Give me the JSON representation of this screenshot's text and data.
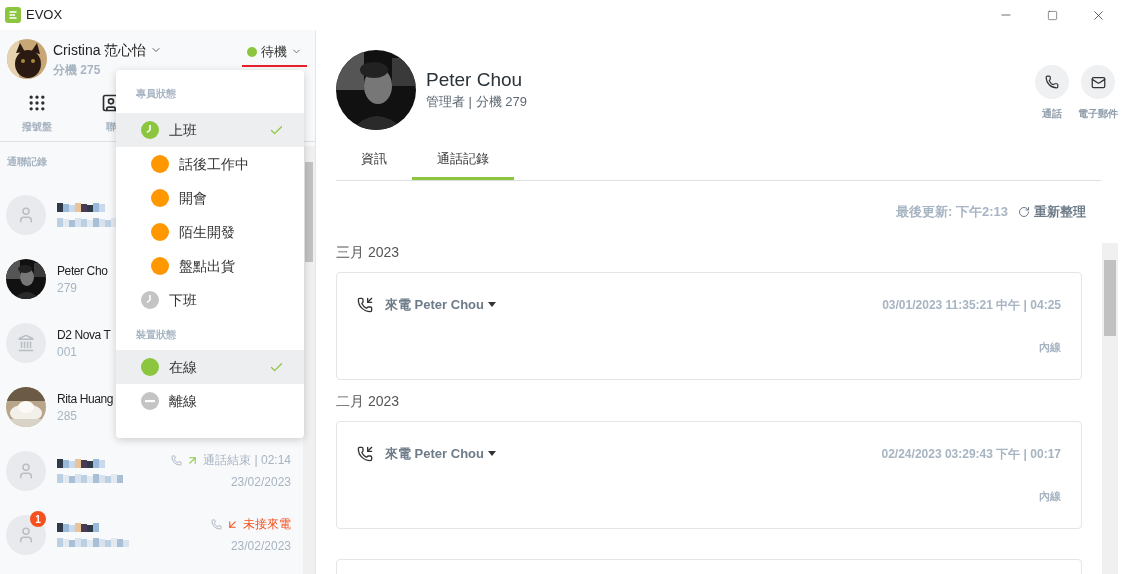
{
  "app": {
    "title": "EVOX"
  },
  "user": {
    "name": "Cristina 范心怡",
    "extension": "分機 275",
    "status": "待機"
  },
  "toolbar": [
    {
      "label": "撥號盤",
      "kind": "dialpad"
    },
    {
      "label": "聯",
      "kind": "contacts"
    }
  ],
  "recent": {
    "title": "通聯記錄",
    "items": [
      {
        "kind": "person"
      },
      {
        "kind": "photo_dark",
        "name": "Peter Cho",
        "sub": "279"
      },
      {
        "kind": "building",
        "name": "D2 Nova T",
        "sub": "001"
      },
      {
        "kind": "photo_light",
        "name": "Rita Huang",
        "sub": "285"
      },
      {
        "kind": "person",
        "call": {
          "kind": "ended",
          "text": "通話結束 | 02:14",
          "date": "23/02/2023"
        }
      },
      {
        "kind": "person",
        "badge": "1",
        "call": {
          "kind": "missed",
          "text": "未接來電",
          "date": "23/02/2023"
        }
      }
    ]
  },
  "status_menu": {
    "sections": [
      {
        "title": "專員狀態",
        "items": [
          {
            "label": "上班",
            "kind": "clock",
            "color": "#8cc63f",
            "selected": true,
            "children": [
              {
                "label": "話後工作中",
                "kind": "dot",
                "color": "#ff9800",
                "selected": false
              },
              {
                "label": "開會",
                "kind": "dot",
                "color": "#ff9800",
                "selected": false
              },
              {
                "label": "陌生開發",
                "kind": "dot",
                "color": "#ff9800",
                "selected": false
              },
              {
                "label": "盤點出貨",
                "kind": "dot",
                "color": "#ff9800",
                "selected": false
              }
            ]
          },
          {
            "label": "下班",
            "kind": "clock",
            "color": "#c4c4c4",
            "selected": false
          }
        ]
      },
      {
        "title": "裝置狀態",
        "items": [
          {
            "label": "在線",
            "kind": "dot",
            "color": "#8cc63f",
            "selected": true
          },
          {
            "label": "離線",
            "kind": "minus",
            "color": "#c4c4c4",
            "selected": false
          }
        ]
      }
    ]
  },
  "contact": {
    "name": "Peter Chou",
    "role": "管理者 | 分機 279",
    "actions": [
      {
        "label": "通話",
        "kind": "call"
      },
      {
        "label": "電子郵件",
        "kind": "email"
      }
    ],
    "tabs": [
      {
        "label": "資訊",
        "selected": false
      },
      {
        "label": "通話記錄",
        "selected": true
      }
    ],
    "last_updated": "最後更新: 下午2:13",
    "refresh": "重新整理",
    "groups": [
      {
        "month": "三月 2023",
        "calls": [
          {
            "title": "來電 Peter Chou",
            "time": "03/01/2023 11:35:21 中午 | 04:25",
            "line": "內線"
          }
        ]
      },
      {
        "month": "二月 2023",
        "calls": [
          {
            "title": "來電 Peter Chou",
            "time": "02/24/2023 03:29:43 下午 | 00:17",
            "line": "內線"
          }
        ]
      }
    ]
  }
}
